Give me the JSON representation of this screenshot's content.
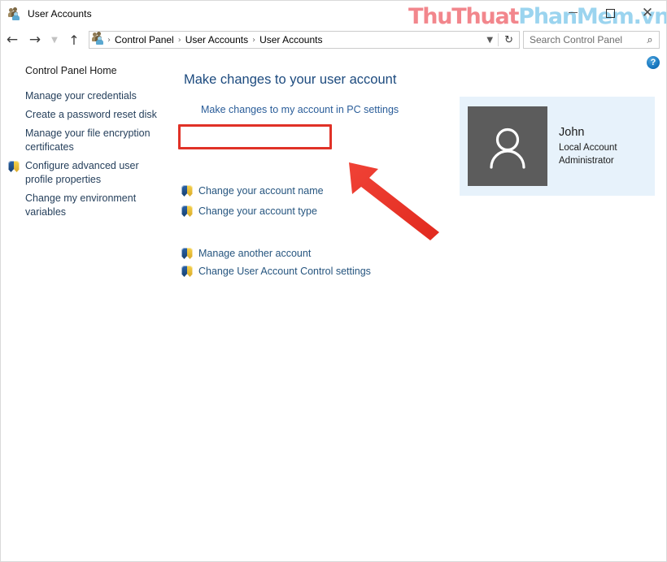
{
  "window": {
    "title": "User Accounts",
    "title_icon": "users-icon",
    "controls": {
      "minimize": "minimize-icon",
      "maximize": "maximize-icon",
      "close": "close-icon"
    }
  },
  "watermark": {
    "part1": "ThuThuat",
    "part2": "PhanMem",
    "part3": ".vn",
    "color1": "#f2868c",
    "color2": "#9bd4ef",
    "color3": "#9bd4ef"
  },
  "navbar": {
    "back": "back-arrow-icon",
    "forward": "forward-arrow-icon",
    "recent": "chevron-down-icon",
    "up": "up-arrow-icon",
    "breadcrumb_icon": "users-icon",
    "breadcrumbs": [
      "Control Panel",
      "User Accounts",
      "User Accounts"
    ],
    "separator": "›",
    "dropdown": "chevron-down-icon",
    "refresh": "refresh-icon",
    "refresh_glyph": "↻"
  },
  "search": {
    "placeholder": "Search Control Panel",
    "icon": "search-icon"
  },
  "help": {
    "label": "?",
    "name": "help-icon"
  },
  "sidebar": {
    "home": "Control Panel Home",
    "items": [
      {
        "label": "Manage your credentials",
        "shield": false
      },
      {
        "label": "Create a password reset disk",
        "shield": false
      },
      {
        "label": "Manage your file encryption certificates",
        "shield": false
      },
      {
        "label": "Configure advanced user profile properties",
        "shield": true
      },
      {
        "label": "Change my environment variables",
        "shield": false
      }
    ]
  },
  "main": {
    "heading": "Make changes to your user account",
    "pc_settings_link": "Make changes to my account in PC settings",
    "links": [
      {
        "label": "Change your account name",
        "shield": true,
        "highlighted": true
      },
      {
        "label": "Change your account type",
        "shield": true,
        "highlighted": false
      },
      {
        "label": "Manage another account",
        "shield": true,
        "highlighted": false
      },
      {
        "label": "Change User Account Control settings",
        "shield": true,
        "highlighted": false
      }
    ]
  },
  "annotations": {
    "highlight_color": "#e03127",
    "arrow_color": "#ec3b30",
    "arrow_name": "red-pointer-arrow"
  },
  "user_panel": {
    "avatar_icon": "user-avatar-icon",
    "name": "John",
    "account_type": "Local Account",
    "role": "Administrator",
    "background": "#e7f2fb"
  }
}
